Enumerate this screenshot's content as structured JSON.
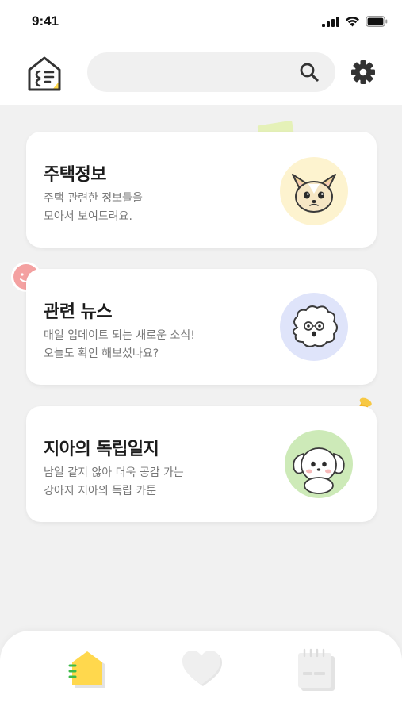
{
  "status_bar": {
    "time": "9:41"
  },
  "header": {
    "logo_icon": "house-document-icon",
    "search": {
      "placeholder": "",
      "value": "",
      "icon": "search-icon"
    },
    "settings_icon": "gear-icon"
  },
  "cards": [
    {
      "title": "주택정보",
      "description": [
        "주택 관련한 정보들을",
        "모아서 보여드려요."
      ],
      "avatar": "chihuahua-avatar",
      "avatar_bg": "#fdf3cf"
    },
    {
      "title": "관련 뉴스",
      "description": [
        "매일 업데이트 되는 새로운 소식!",
        "오늘도 확인 해보셨나요?"
      ],
      "avatar": "fluffy-dog-avatar",
      "avatar_bg": "#dfe4fa"
    },
    {
      "title": "지아의 독립일지",
      "description": [
        "남일 같지 않아 더욱 공감 가는",
        "강아지 지아의 독립 카툰"
      ],
      "avatar": "white-puppy-avatar",
      "avatar_bg": "#cdeab8"
    }
  ],
  "bottom_nav": {
    "items": [
      {
        "name": "home",
        "icon": "home-icon",
        "active": true
      },
      {
        "name": "favorites",
        "icon": "heart-icon",
        "active": false
      },
      {
        "name": "notes",
        "icon": "notebook-icon",
        "active": false
      }
    ]
  },
  "colors": {
    "background": "#f1f1f1",
    "card": "#ffffff",
    "accent_yellow": "#ffd84d",
    "accent_green": "#3dbb4a",
    "inactive_icon": "#e9e9e9"
  }
}
